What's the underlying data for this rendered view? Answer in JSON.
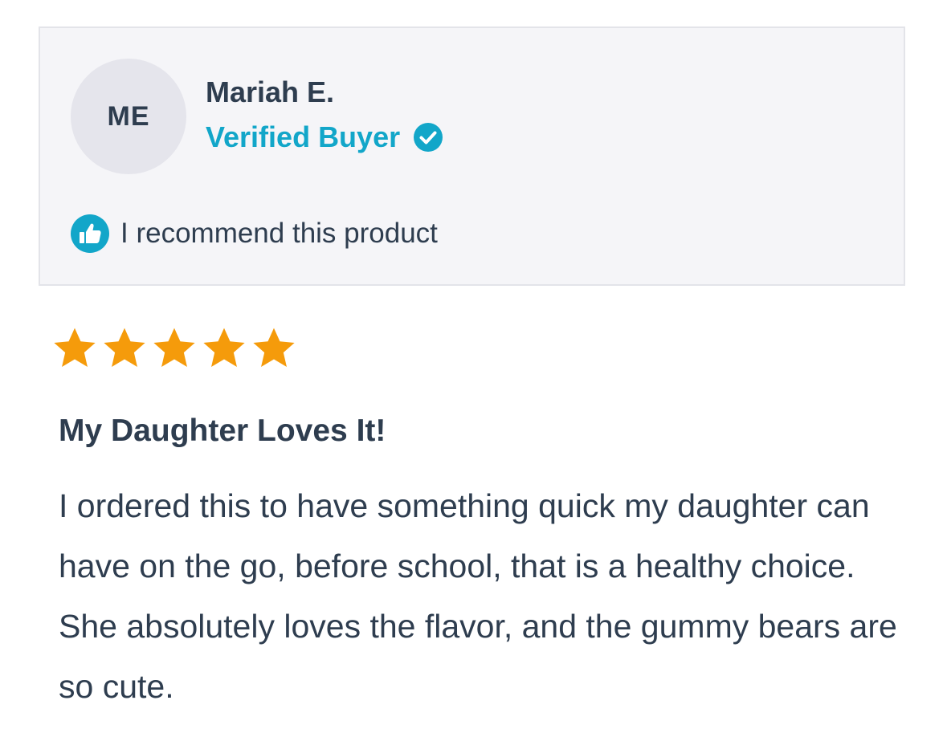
{
  "reviewer": {
    "initials": "ME",
    "name": "Mariah E.",
    "badge": "Verified Buyer"
  },
  "recommendation": {
    "text": "I recommend this product"
  },
  "rating": {
    "value": 5,
    "max": 5
  },
  "review": {
    "title": "My Daughter Loves It!",
    "body": "I ordered this to have something quick my daughter can have on the go, before school, that is a healthy choice. She absolutely loves the flavor, and the gummy bears are so cute."
  },
  "colors": {
    "accent": "#12a6c9",
    "star": "#f59b0b",
    "text": "#2e3d4f",
    "card_bg": "#f5f5f8"
  },
  "icons": {
    "verified": "check-circle-icon",
    "recommend": "thumbs-up-icon",
    "star": "star-icon"
  }
}
